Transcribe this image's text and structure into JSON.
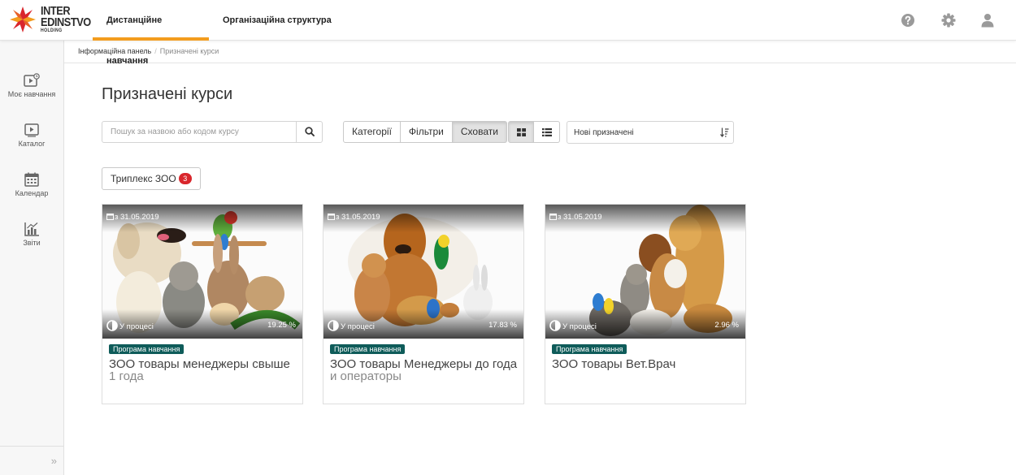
{
  "brand": {
    "line1": "INTER",
    "line2": "EDINSTVO",
    "line3": "HOLDING",
    "accent": "#f39c1e",
    "logo_red": "#d9262c"
  },
  "nav": {
    "tabs": [
      {
        "label": "Дистанційне навчання"
      },
      {
        "label": "Організаційна структура"
      }
    ]
  },
  "top_icons": [
    "help-icon",
    "settings-icon",
    "user-icon"
  ],
  "sidebar": {
    "items": [
      {
        "label": "Моє навчання",
        "icon": "my-learning-icon"
      },
      {
        "label": "Каталог",
        "icon": "catalog-icon"
      },
      {
        "label": "Календар",
        "icon": "calendar-icon"
      },
      {
        "label": "Звіти",
        "icon": "reports-icon"
      }
    ],
    "collapse_label": "»"
  },
  "breadcrumb": {
    "items": [
      "Інформаційна панель",
      "Призначені курси"
    ],
    "separator": "/"
  },
  "page": {
    "title": "Призначені курси"
  },
  "search": {
    "placeholder": "Пошук за назвою або кодом курсу",
    "value": ""
  },
  "filter_buttons": {
    "categories": "Категорії",
    "filters": "Фільтри",
    "hide": "Сховати"
  },
  "view_modes": {
    "grid": "grid-view-icon",
    "list": "list-view-icon",
    "active": "grid"
  },
  "sort": {
    "value": "Нові призначені",
    "icon": "sort-descending-icon"
  },
  "tag_filter": {
    "label": "Триплекс ЗОО",
    "count": "3",
    "badge_color": "#d9262c"
  },
  "courses": [
    {
      "date": "з 31.05.2019",
      "status": "У процесі",
      "progress": "19.25 %",
      "type": "Програма навчання",
      "title_main": "ЗОО товары менеджеры свыше",
      "title_rest": "1 года"
    },
    {
      "date": "з 31.05.2019",
      "status": "У процесі",
      "progress": "17.83 %",
      "type": "Програма навчання",
      "title_main": "ЗОО товары Менеджеры до года",
      "title_rest": "и операторы"
    },
    {
      "date": "з 31.05.2019",
      "status": "У процесі",
      "progress": "2.96 %",
      "type": "Програма навчання",
      "title_main": "ЗОО товары Вет.Врач",
      "title_rest": ""
    }
  ],
  "colors": {
    "program_label": "#0f5c5a",
    "active_tab_underline": "#f39c1e"
  }
}
